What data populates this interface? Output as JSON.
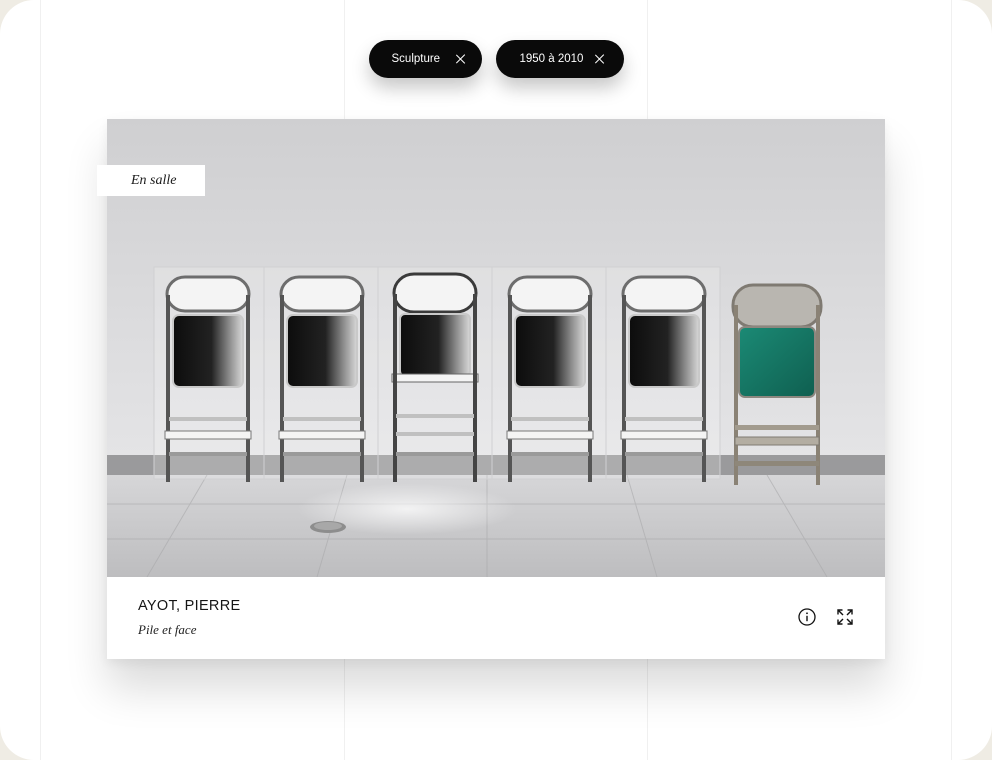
{
  "filters": [
    {
      "label": "Sculpture",
      "remove_icon": "close-icon"
    },
    {
      "label": "1950 à 2010",
      "remove_icon": "close-icon"
    }
  ],
  "artwork": {
    "status_badge": "En salle",
    "artist": "AYOT, PIERRE",
    "title": "Pile et face",
    "image": "photograph of six folding chairs leaning against a white wall",
    "actions": {
      "info_icon": "info-icon",
      "expand_icon": "fullscreen-icon"
    }
  },
  "colors": {
    "chip_background": "#0a0a0a",
    "chip_text": "#ffffff",
    "background": "#efece4",
    "accent_chair": "#157a68"
  }
}
